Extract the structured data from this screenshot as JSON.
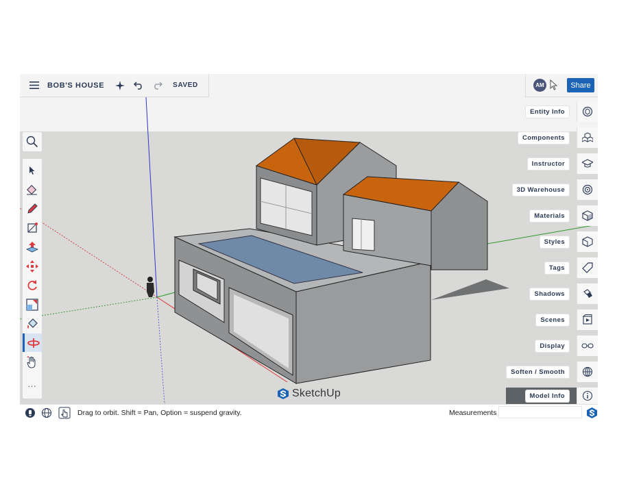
{
  "document": {
    "title": "BOB'S HOUSE",
    "save_state": "SAVED"
  },
  "topbar": {
    "icons": [
      "hamburger-menu-icon",
      "sparkle-icon",
      "undo-icon",
      "redo-icon"
    ]
  },
  "user": {
    "initials": "AM"
  },
  "share_label": "Share",
  "left_toolbar": {
    "search_icon": "magnifier-icon",
    "tools": [
      "select-arrow-icon",
      "eraser-icon",
      "pencil-icon",
      "rectangle-icon",
      "push-pull-icon",
      "move-icon",
      "rotate-icon",
      "scale-icon",
      "paint-bucket-icon",
      "orbit-icon",
      "pan-hand-icon"
    ],
    "active_tool": "orbit-icon",
    "more_label": "..."
  },
  "right_panels": [
    {
      "label": "Entity Info",
      "icon": "entity-info-icon"
    },
    {
      "label": "Components",
      "icon": "components-icon"
    },
    {
      "label": "Instructor",
      "icon": "instructor-cap-icon"
    },
    {
      "label": "3D Warehouse",
      "icon": "warehouse-icon"
    },
    {
      "label": "Materials",
      "icon": "materials-cube-icon"
    },
    {
      "label": "Styles",
      "icon": "styles-icon"
    },
    {
      "label": "Tags",
      "icon": "tag-icon"
    },
    {
      "label": "Shadows",
      "icon": "shadows-icon"
    },
    {
      "label": "Scenes",
      "icon": "scenes-icon"
    },
    {
      "label": "Display",
      "icon": "glasses-icon"
    },
    {
      "label": "Soften / Smooth",
      "icon": "sphere-icon"
    },
    {
      "label": "Model Info",
      "icon": "info-icon"
    }
  ],
  "statusbar": {
    "hint": "Drag to orbit. Shift = Pan, Option = suspend gravity.",
    "measurements_label": "Measurements",
    "measurements_value": ""
  },
  "branding": {
    "logo_text": "SketchUp"
  },
  "colors": {
    "accent": "#1a63b5",
    "roof": "#c8630e",
    "wall": "#8f9193",
    "pool": "#6f8aa8",
    "sky": "#f3f3f3",
    "ground": "#d9d9d7"
  }
}
